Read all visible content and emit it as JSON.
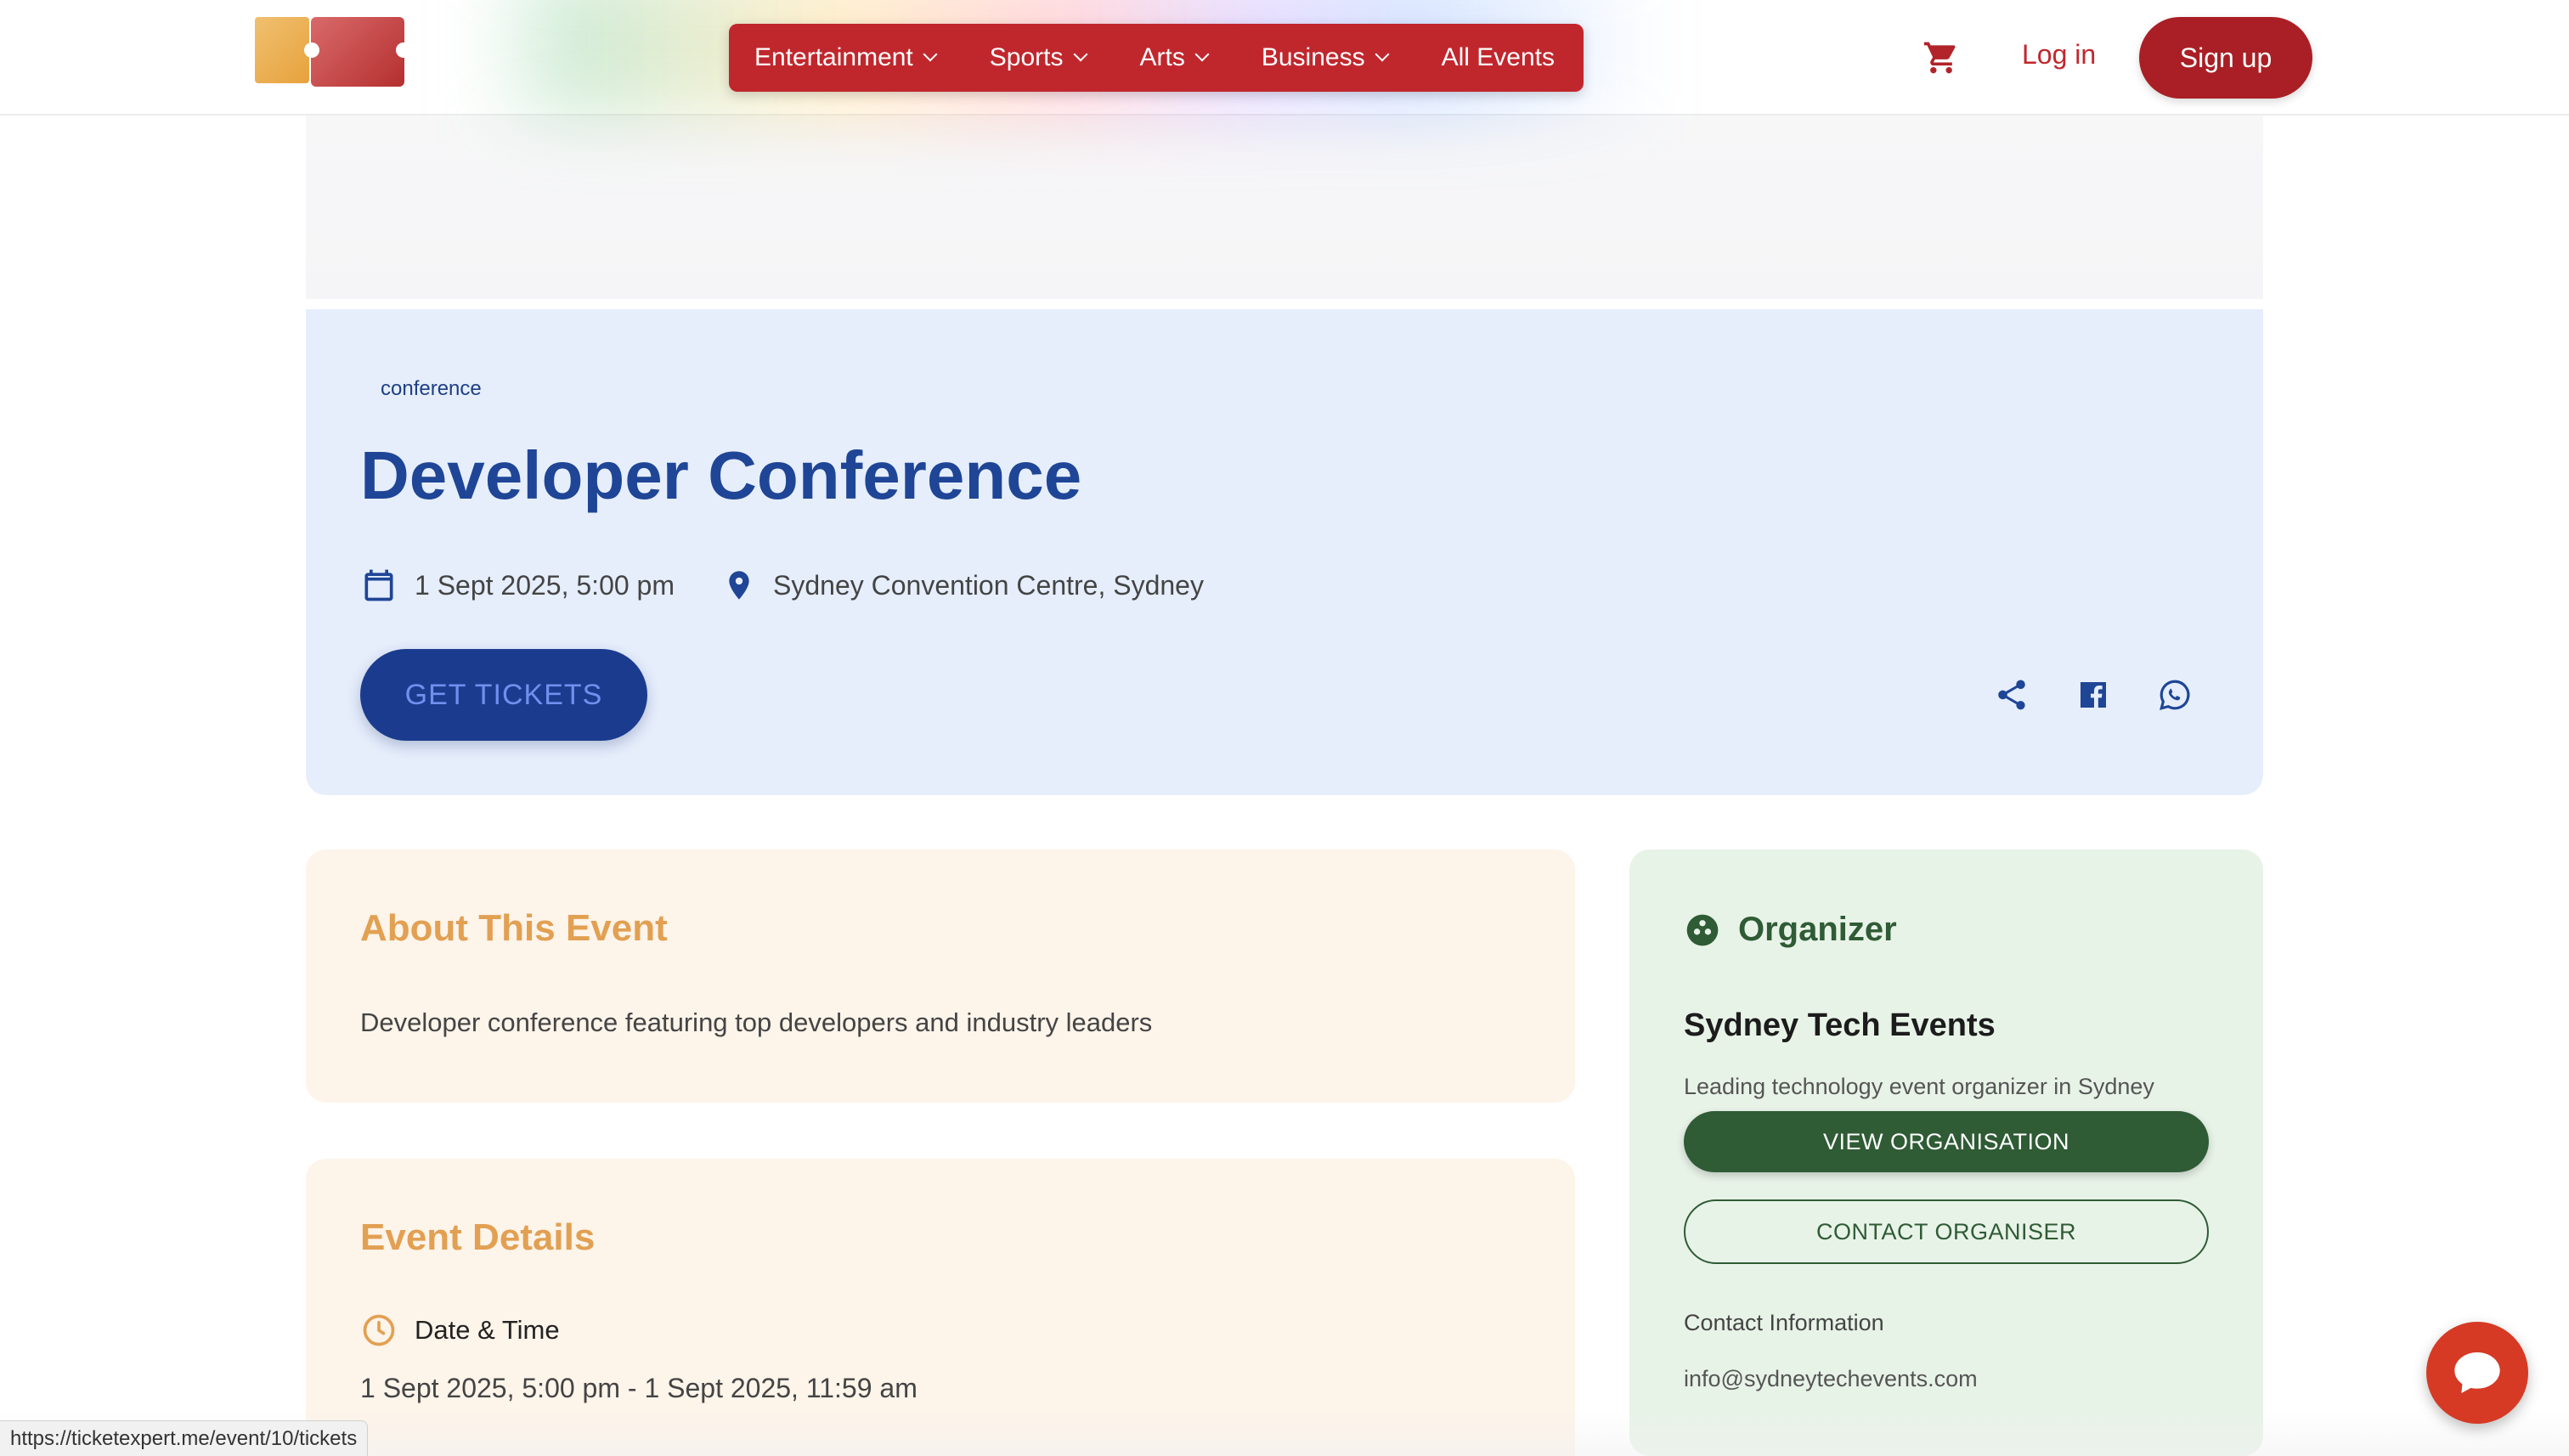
{
  "header": {
    "nav": [
      {
        "label": "Entertainment",
        "has_dropdown": true
      },
      {
        "label": "Sports",
        "has_dropdown": true
      },
      {
        "label": "Arts",
        "has_dropdown": true
      },
      {
        "label": "Business",
        "has_dropdown": true
      },
      {
        "label": "All Events",
        "has_dropdown": false
      }
    ],
    "cart_icon": "cart-icon",
    "login_label": "Log in",
    "signup_label": "Sign up",
    "colors": {
      "brand_red": "#c0272d"
    }
  },
  "event": {
    "category_tag": "conference",
    "title": "Developer Conference",
    "datetime": "1 Sept 2025, 5:00 pm",
    "venue": "Sydney Convention Centre, Sydney",
    "cta_label": "GET TICKETS",
    "share_icons": [
      "share-icon",
      "facebook-icon",
      "whatsapp-icon"
    ],
    "colors": {
      "title": "#1f4596",
      "banner_bg": "#e6eefc"
    }
  },
  "about": {
    "heading": "About This Event",
    "description": "Developer conference featuring top developers and industry leaders"
  },
  "details": {
    "heading": "Event Details",
    "datetime_label": "Date & Time",
    "datetime_value": "1 Sept 2025, 5:00 pm - 1 Sept 2025, 11:59 am"
  },
  "organizer": {
    "heading": "Organizer",
    "name": "Sydney Tech Events",
    "description": "Leading technology event organizer in Sydney",
    "view_label": "VIEW ORGANISATION",
    "contact_label": "CONTACT ORGANISER",
    "contact_info_label": "Contact Information",
    "email": "info@sydneytechevents.com",
    "colors": {
      "accent": "#2f5b35",
      "card_bg": "#e8f3e8"
    }
  },
  "status_bar": {
    "url": "https://ticketexpert.me/event/10/tickets"
  },
  "chat": {
    "icon": "chat-bubble-icon"
  }
}
